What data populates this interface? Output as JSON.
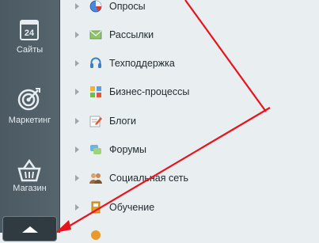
{
  "leftnav": {
    "sites_label": "Сайты",
    "sites_icon_text": "24",
    "marketing_label": "Маркетинг",
    "shop_label": "Магазин"
  },
  "menu": {
    "items": [
      {
        "label": "Опросы",
        "icon": "pie-chart-icon"
      },
      {
        "label": "Рассылки",
        "icon": "mail-icon"
      },
      {
        "label": "Техподдержка",
        "icon": "headset-icon"
      },
      {
        "label": "Бизнес-процессы",
        "icon": "workflow-icon"
      },
      {
        "label": "Блоги",
        "icon": "blog-edit-icon"
      },
      {
        "label": "Форумы",
        "icon": "forum-bubbles-icon"
      },
      {
        "label": "Социальная сеть",
        "icon": "social-network-icon"
      },
      {
        "label": "Обучение",
        "icon": "learning-book-icon"
      }
    ]
  },
  "colors": {
    "annotation": "#e8141c",
    "nav_bg": "#4f5e66",
    "panel_bg": "#e9eef0"
  }
}
